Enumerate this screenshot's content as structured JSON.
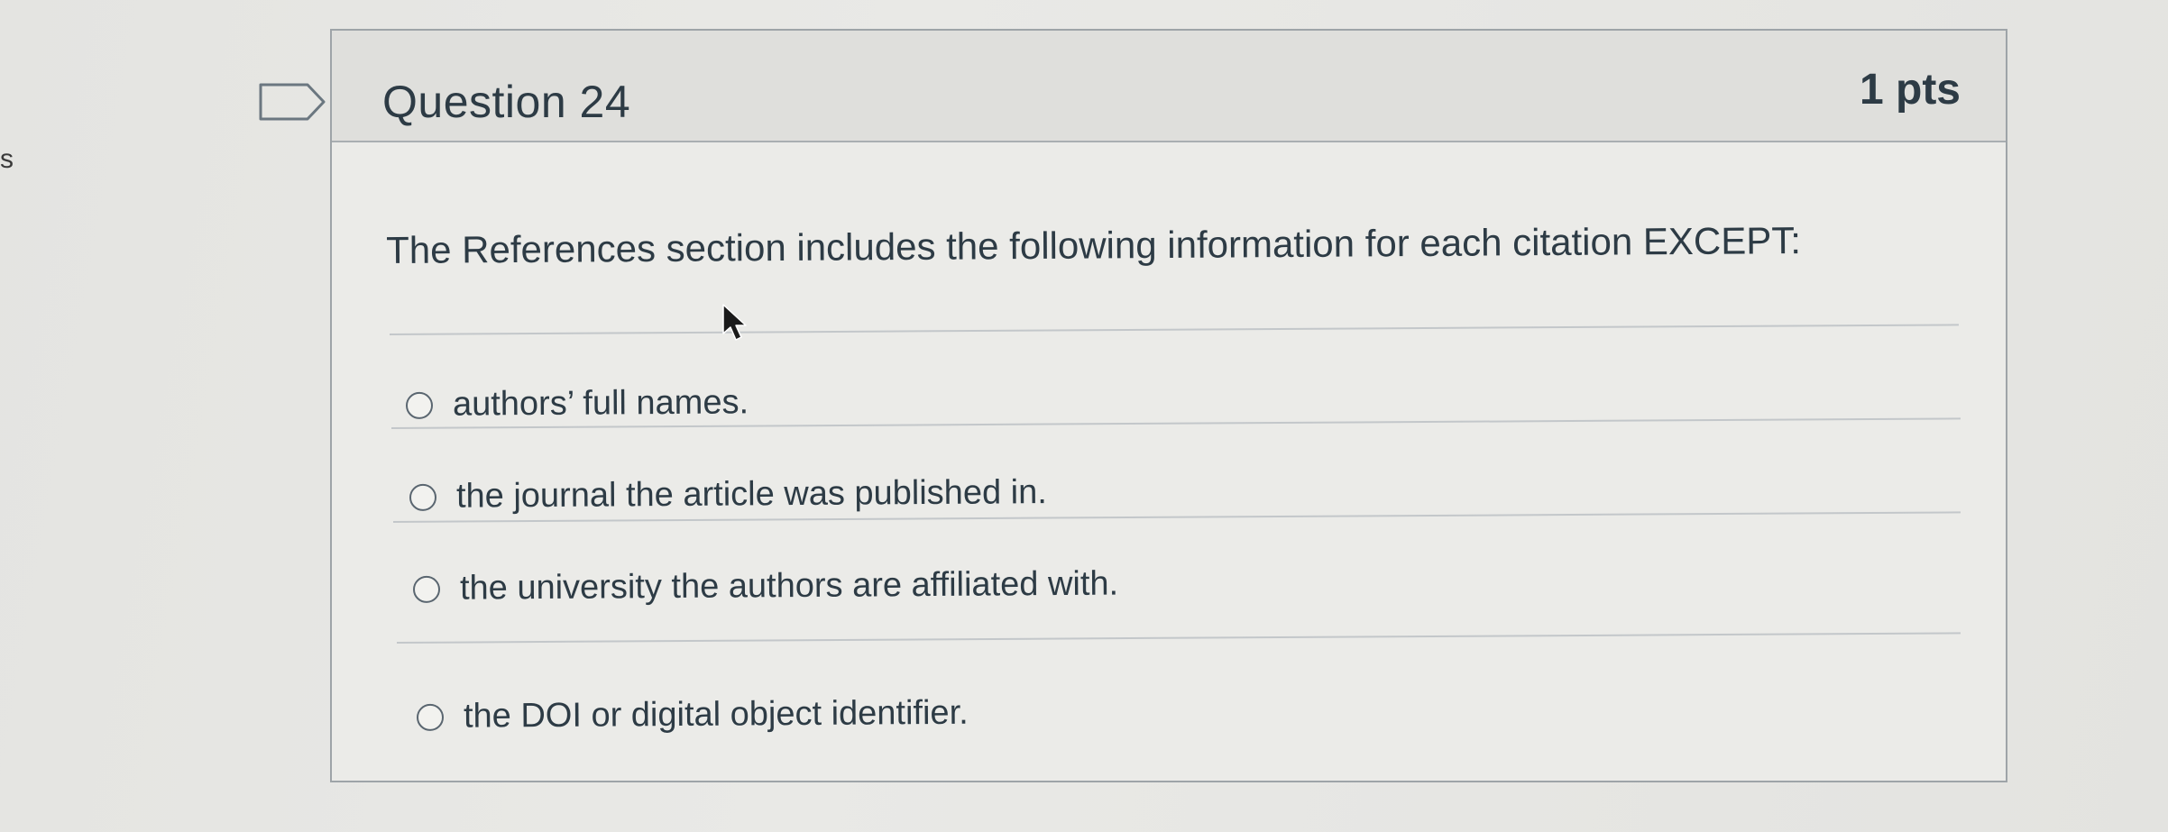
{
  "edge_glyph": "s",
  "question": {
    "title": "Question 24",
    "points": "1 pts",
    "text": "The References section includes the following information for each citation EXCEPT:",
    "answers": [
      {
        "label": "authors’ full names."
      },
      {
        "label": "the journal the article was published in."
      },
      {
        "label": "the university the authors are affiliated with."
      },
      {
        "label": "the DOI or digital object identifier."
      }
    ]
  },
  "colors": {
    "text": "#2d3b45",
    "header_bg": "#dfdfdc",
    "card_bg": "#ebebe8",
    "border": "#9ea4a8"
  },
  "icons": {
    "flag": "flag-outline-icon",
    "cursor": "mouse-pointer-icon",
    "radio": "radio-unselected-icon"
  }
}
